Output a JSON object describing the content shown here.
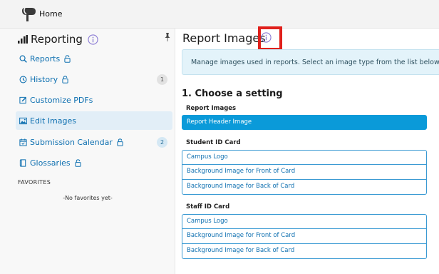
{
  "topbar": {
    "home_label": "Home"
  },
  "sidebar": {
    "title": "Reporting",
    "items": [
      {
        "label": "Reports",
        "icon": "search-icon",
        "locked": true
      },
      {
        "label": "History",
        "icon": "history-icon",
        "locked": true,
        "badge": "1"
      },
      {
        "label": "Customize PDFs",
        "icon": "edit-icon",
        "locked": false
      },
      {
        "label": "Edit Images",
        "icon": "image-icon",
        "locked": false,
        "active": true
      },
      {
        "label": "Submission Calendar",
        "icon": "calendar-icon",
        "locked": true,
        "badge": "2"
      },
      {
        "label": "Glossaries",
        "icon": "book-icon",
        "locked": true
      }
    ],
    "favorites_heading": "FAVORITES",
    "favorites_empty": "-No favorites yet-"
  },
  "main": {
    "title": "Report Images",
    "banner": "Manage images used in reports. Select an image type from the list below to",
    "step_title": "1. Choose a setting",
    "groups": [
      {
        "title": "Report Images",
        "options": [
          "Report Header Image"
        ]
      },
      {
        "title": "Student ID Card",
        "options": [
          "Campus Logo",
          "Background Image for Front of Card",
          "Background Image for Back of Card"
        ]
      },
      {
        "title": "Staff ID Card",
        "options": [
          "Campus Logo",
          "Background Image for Front of Card",
          "Background Image for Back of Card"
        ]
      }
    ],
    "selected_option": "Report Header Image"
  },
  "colors": {
    "accent": "#0a9ad9",
    "link": "#0d6fb0",
    "highlight": "#e0201b",
    "banner_bg": "#e3f3fa"
  }
}
